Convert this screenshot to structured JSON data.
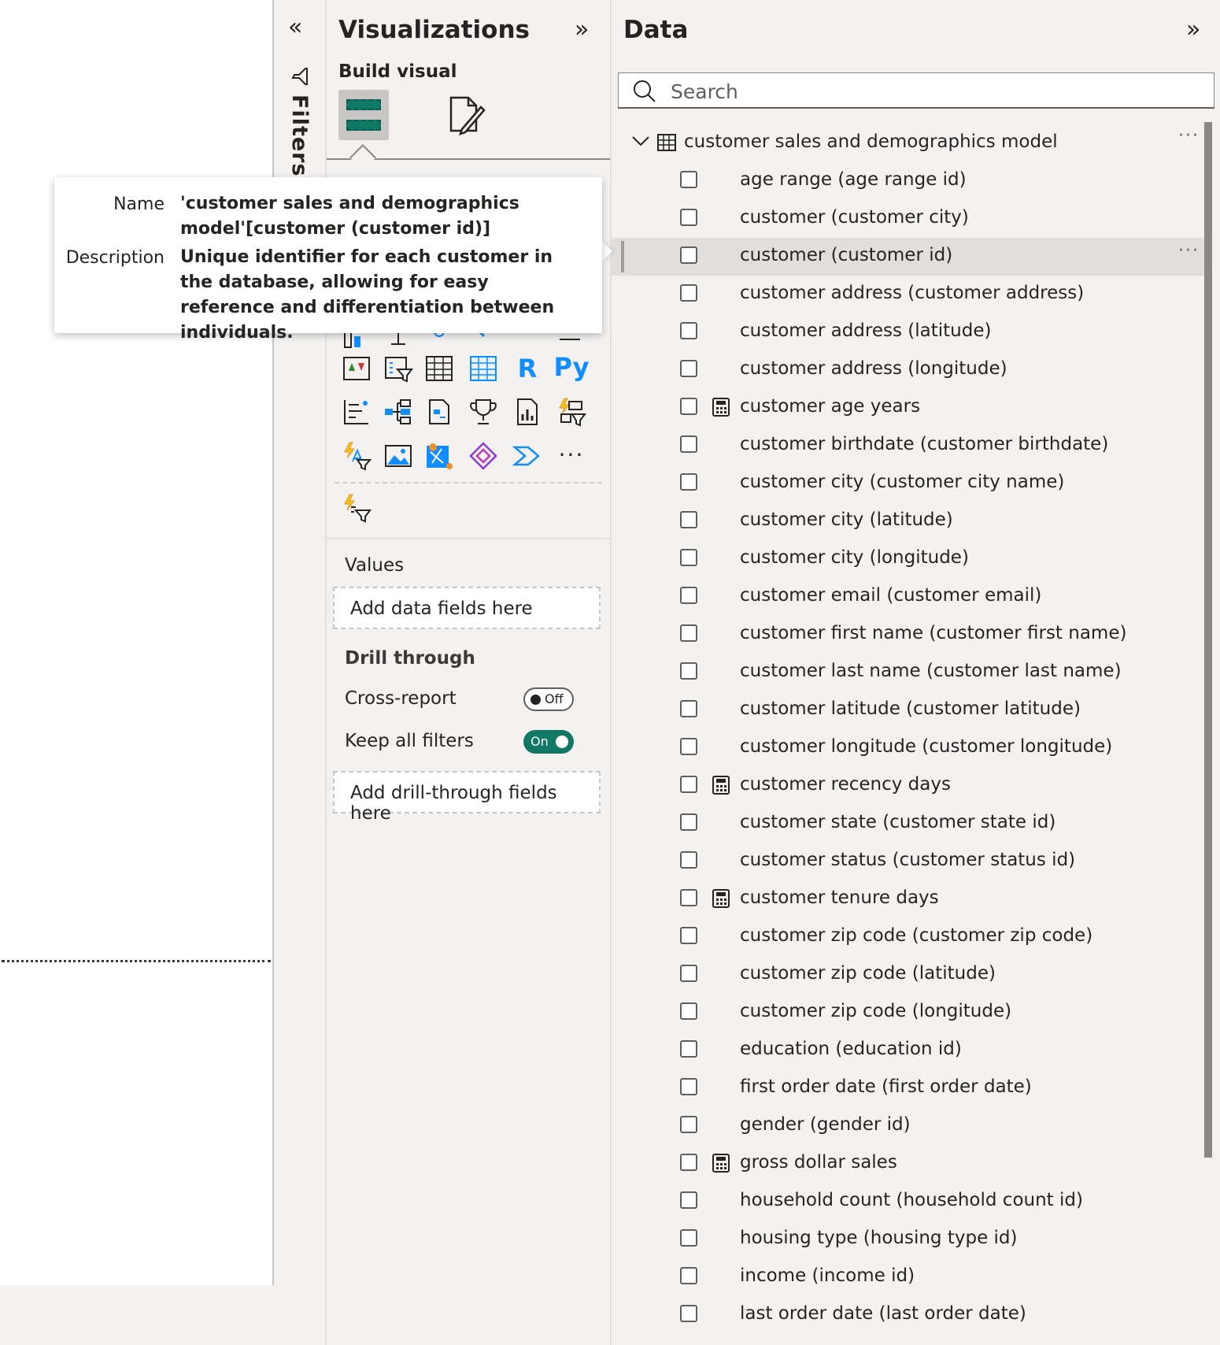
{
  "filters": {
    "label": "Filters",
    "collapse_icon": "chevrons-left-icon"
  },
  "visualizations": {
    "title": "Visualizations",
    "build_visual_label": "Build visual",
    "r_label": "R",
    "py_label": "Py",
    "more_label": "···",
    "values_label": "Values",
    "values_placeholder": "Add data fields here",
    "drill_through_label": "Drill through",
    "cross_report_label": "Cross-report",
    "cross_report_toggle": "Off",
    "keep_filters_label": "Keep all filters",
    "keep_filters_toggle": "On",
    "drill_placeholder": "Add drill-through fields here"
  },
  "data": {
    "title": "Data",
    "search_placeholder": "Search",
    "model_name": "customer sales and demographics model",
    "more_label": "···",
    "fields": [
      {
        "label": "age range (age range id)",
        "calc": false
      },
      {
        "label": "customer (customer city)",
        "calc": false
      },
      {
        "label": "customer (customer id)",
        "calc": false,
        "selected": true
      },
      {
        "label": "customer address (customer address)",
        "calc": false
      },
      {
        "label": "customer address (latitude)",
        "calc": false
      },
      {
        "label": "customer address (longitude)",
        "calc": false
      },
      {
        "label": "customer age years",
        "calc": true
      },
      {
        "label": "customer birthdate (customer birthdate)",
        "calc": false
      },
      {
        "label": "customer city (customer city name)",
        "calc": false
      },
      {
        "label": "customer city (latitude)",
        "calc": false
      },
      {
        "label": "customer city (longitude)",
        "calc": false
      },
      {
        "label": "customer email (customer email)",
        "calc": false
      },
      {
        "label": "customer first name (customer first name)",
        "calc": false
      },
      {
        "label": "customer last name (customer last name)",
        "calc": false
      },
      {
        "label": "customer latitude (customer latitude)",
        "calc": false
      },
      {
        "label": "customer longitude (customer longitude)",
        "calc": false
      },
      {
        "label": "customer recency days",
        "calc": true
      },
      {
        "label": "customer state (customer state id)",
        "calc": false
      },
      {
        "label": "customer status (customer status id)",
        "calc": false
      },
      {
        "label": "customer tenure days",
        "calc": true
      },
      {
        "label": "customer zip code (customer zip code)",
        "calc": false
      },
      {
        "label": "customer zip code (latitude)",
        "calc": false
      },
      {
        "label": "customer zip code (longitude)",
        "calc": false
      },
      {
        "label": "education (education id)",
        "calc": false
      },
      {
        "label": "first order date (first order date)",
        "calc": false
      },
      {
        "label": "gender (gender id)",
        "calc": false
      },
      {
        "label": "gross dollar sales",
        "calc": true
      },
      {
        "label": "household count (household count id)",
        "calc": false
      },
      {
        "label": "housing type (housing type id)",
        "calc": false
      },
      {
        "label": "income (income id)",
        "calc": false
      },
      {
        "label": "last order date (last order date)",
        "calc": false
      }
    ]
  },
  "tooltip": {
    "name_key": "Name",
    "name_value": "'customer sales and demographics model'[customer (customer id)]",
    "description_key": "Description",
    "description_value": "Unique identifier for each customer in the database, allowing for easy reference and differentiation between individuals."
  },
  "colors": {
    "accent": "#117865",
    "visual_blue": "#118dff"
  }
}
